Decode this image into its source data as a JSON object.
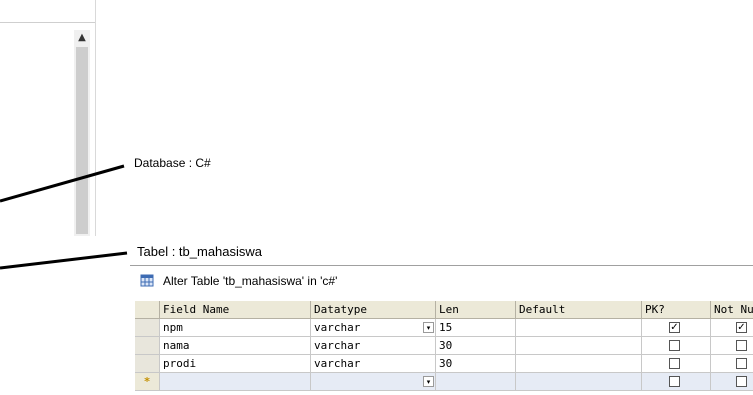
{
  "annotations": {
    "database_label": "Database : C#",
    "table_label": "Tabel : tb_mahasiswa"
  },
  "alter_table": {
    "title": "Alter Table 'tb_mahasiswa' in 'c#'",
    "icon": "table-grid-icon"
  },
  "grid": {
    "columns": [
      "Field Name",
      "Datatype",
      "Len",
      "Default",
      "PK?",
      "Not Nu"
    ],
    "rows": [
      {
        "field": "npm",
        "datatype": "varchar",
        "len": "15",
        "default": "",
        "pk": true,
        "not_null": true
      },
      {
        "field": "nama",
        "datatype": "varchar",
        "len": "30",
        "default": "",
        "pk": false,
        "not_null": false
      },
      {
        "field": "prodi",
        "datatype": "varchar",
        "len": "30",
        "default": "",
        "pk": false,
        "not_null": false
      }
    ],
    "new_row_marker": "*"
  },
  "scrollbar": {
    "up_arrow": "▲"
  },
  "dropdown_glyph": "▾",
  "check_glyph": "✓",
  "colors": {
    "header_bg": "#ece9d8",
    "new_row_bg": "#e6ebf5",
    "pointer_line": "#000000"
  }
}
